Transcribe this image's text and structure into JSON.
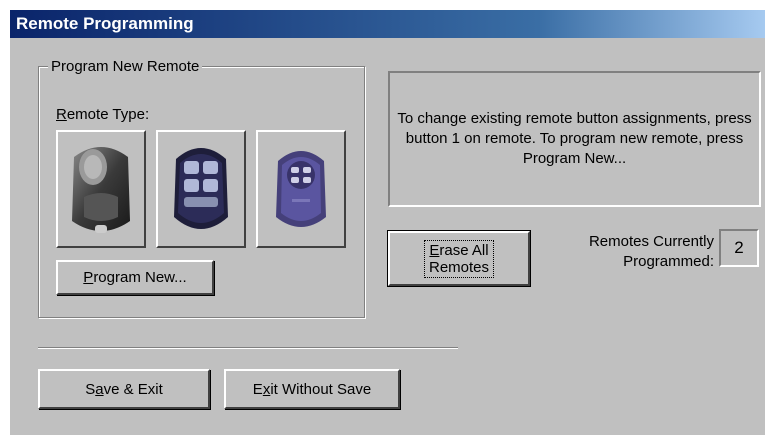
{
  "window": {
    "title": "Remote Programming"
  },
  "group": {
    "legend": "Program New Remote",
    "remote_type_label_mnemonic": "R",
    "remote_type_label_rest": "emote Type:",
    "remote_types": [
      {
        "icon": "remote-oval-grey-icon"
      },
      {
        "icon": "remote-four-button-icon"
      },
      {
        "icon": "remote-purple-icon"
      }
    ],
    "program_new_mnemonic": "P",
    "program_new_rest": "rogram New..."
  },
  "info": {
    "message": "To change existing remote button assignments, press button 1 on remote. To program new remote, press Program New..."
  },
  "erase": {
    "line1_mnemonic": "E",
    "line1_rest": "rase All",
    "line2": "Remotes"
  },
  "count": {
    "label": "Remotes Currently Programmed:",
    "value": "2"
  },
  "footer": {
    "save_pre": "S",
    "save_mnemonic": "a",
    "save_post": "ve & Exit",
    "exit_pre": "E",
    "exit_mnemonic": "x",
    "exit_post": "it Without Save"
  },
  "colors": {
    "face": "#c0c0c0",
    "title_start": "#0a246a",
    "title_end": "#a6caf0"
  }
}
